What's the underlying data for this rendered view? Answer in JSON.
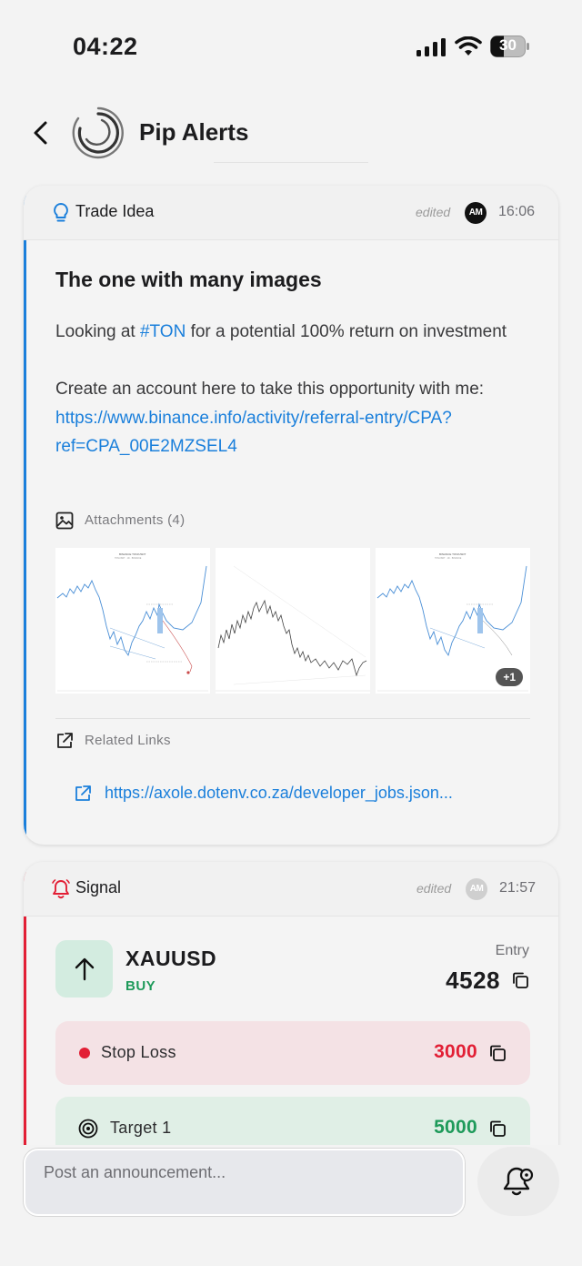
{
  "status_bar": {
    "time": "04:22",
    "battery_level": "30"
  },
  "header": {
    "title": "Pip Alerts",
    "back_icon": "chevron-left-icon",
    "logo_icon": "spiral-logo-icon"
  },
  "posts": [
    {
      "type_label": "Trade Idea",
      "type_icon": "lightbulb-icon",
      "accent_color": "#1a7fdb",
      "edited_label": "edited",
      "author_initials": "AM",
      "time": "16:06",
      "title": "The one with many images",
      "body_prefix": "Looking at ",
      "hashtag": "#TON",
      "body_suffix": " for a potential 100% return on investment",
      "cta_text": "Create an account here to take this opportunity with me:",
      "cta_link": "https://www.binance.info/activity/referral-entry/CPA?ref=CPA_00E2MZSEL4",
      "attachments_label": "Attachments (4)",
      "more_attachments": "+1",
      "related_links_label": "Related Links",
      "related_links": [
        "https://axole.dotenv.co.za/developer_jobs.json..."
      ]
    },
    {
      "type_label": "Signal",
      "type_icon": "bell-alert-icon",
      "accent_color": "#e21f35",
      "edited_label": "edited",
      "author_initials": "AM",
      "time": "21:57",
      "pair": "XAUUSD",
      "direction": "BUY",
      "direction_icon": "arrow-up-icon",
      "entry_label": "Entry",
      "entry_value": "4528",
      "stop_loss_label": "Stop Loss",
      "stop_loss_value": "3000",
      "stop_loss_color": "#e21f35",
      "target_label": "Target 1",
      "target_value": "5000",
      "target_color": "#1e9a5a"
    }
  ],
  "composer": {
    "placeholder": "Post an announcement...",
    "action_icon": "bell-settings-icon"
  }
}
